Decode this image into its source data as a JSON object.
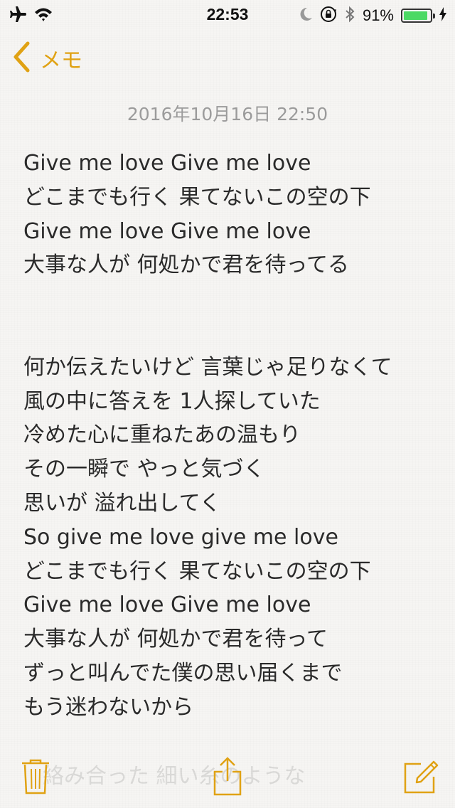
{
  "status_bar": {
    "time": "22:53",
    "battery_percent": "91%",
    "battery_level": 0.91,
    "icons": [
      "airplane-icon",
      "wifi-icon",
      "moon-icon",
      "orientation-lock-icon",
      "bluetooth-icon",
      "battery-icon",
      "charging-icon"
    ]
  },
  "nav": {
    "back_label": "メモ"
  },
  "note": {
    "date": "2016年10月16日 22:50",
    "lines": [
      "Give me love Give me love",
      "どこまでも行く 果てないこの空の下",
      "Give me love Give me love",
      "大事な人が 何処かで君を待ってる",
      "",
      "",
      "何か伝えたいけど 言葉じゃ足りなくて",
      "風の中に答えを 1人探していた",
      "冷めた心に重ねたあの温もり",
      "その一瞬で やっと気づく",
      "思いが 溢れ出してく",
      "So give me love give me love",
      "どこまでも行く 果てないこの空の下",
      "Give me love Give me love",
      "大事な人が 何処かで君を待って",
      "ずっと叫んでた僕の思い届くまで",
      "もう迷わないから"
    ],
    "faded_line": "絡み合った 細い糸のような"
  },
  "toolbar": {
    "icons": [
      "trash-icon",
      "share-icon",
      "compose-icon"
    ]
  },
  "colors": {
    "accent": "#e0a214",
    "battery_fill": "#4cd964",
    "date_text": "#9b9b9b",
    "body_text": "#2a2a2a"
  }
}
